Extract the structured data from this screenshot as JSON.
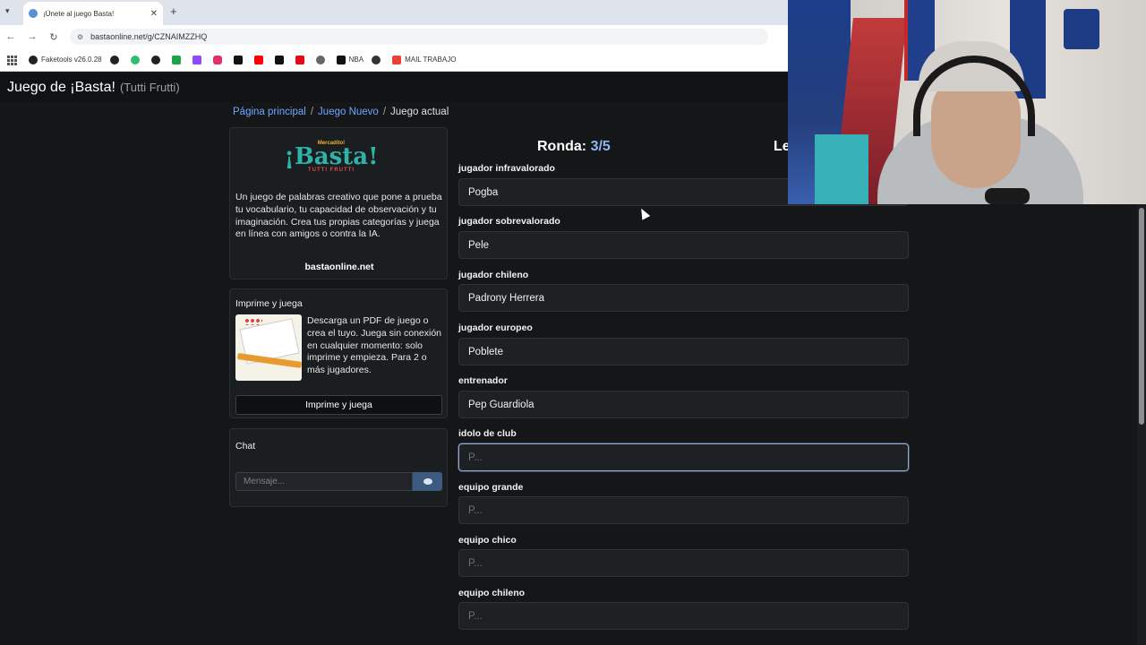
{
  "browser": {
    "tab_title": "¡Únete al juego Basta!",
    "url": "bastaonline.net/g/CZNAIMZZHQ",
    "bookmarks": [
      "Faketools v26.0.28",
      "NBA",
      "MAIL TRABAJO"
    ]
  },
  "site": {
    "brand": "Juego de ¡Basta!",
    "brand_sub": "(Tutti Frutti)"
  },
  "breadcrumb": {
    "home": "Página principal",
    "new_game": "Juego Nuevo",
    "current": "Juego actual",
    "separator": "/"
  },
  "about_card": {
    "logo_top": "Mercadito!",
    "logo_main": "¡Basta!",
    "logo_sub": "TUTTI FRUTTI",
    "description": "Un juego de palabras creativo que pone a prueba tu vocabulario, tu capacidad de observación y tu imaginación. Crea tus propias categorías y juega en línea con amigos o contra la IA.",
    "site": "bastaonline.net"
  },
  "print_card": {
    "title": "Imprime y juega",
    "text": "Descarga un PDF de juego o crea el tuyo. Juega sin conexión en cualquier momento: solo imprime y empieza. Para 2 o más jugadores.",
    "button": "Imprime y juega"
  },
  "chat": {
    "title": "Chat",
    "placeholder": "Mensaje..."
  },
  "round": {
    "label": "Ronda:",
    "value": "3/5",
    "letter_label_partial": "Le"
  },
  "fields": [
    {
      "label": "jugador infravalorado",
      "value": "Pogba",
      "placeholder": "P..."
    },
    {
      "label": "jugador sobrevalorado",
      "value": "Pele",
      "placeholder": "P..."
    },
    {
      "label": "jugador chileno",
      "value": "Padrony Herrera",
      "placeholder": "P..."
    },
    {
      "label": "jugador europeo",
      "value": "Poblete",
      "placeholder": "P..."
    },
    {
      "label": "entrenador",
      "value": "Pep Guardiola",
      "placeholder": "P..."
    },
    {
      "label": "idolo de club",
      "value": "",
      "placeholder": "P..."
    },
    {
      "label": "equipo grande",
      "value": "",
      "placeholder": "P..."
    },
    {
      "label": "equipo chico",
      "value": "",
      "placeholder": "P..."
    },
    {
      "label": "equipo chileno",
      "value": "",
      "placeholder": "P..."
    }
  ],
  "colors": {
    "accent": "#6ea8fe",
    "background": "#141618"
  }
}
